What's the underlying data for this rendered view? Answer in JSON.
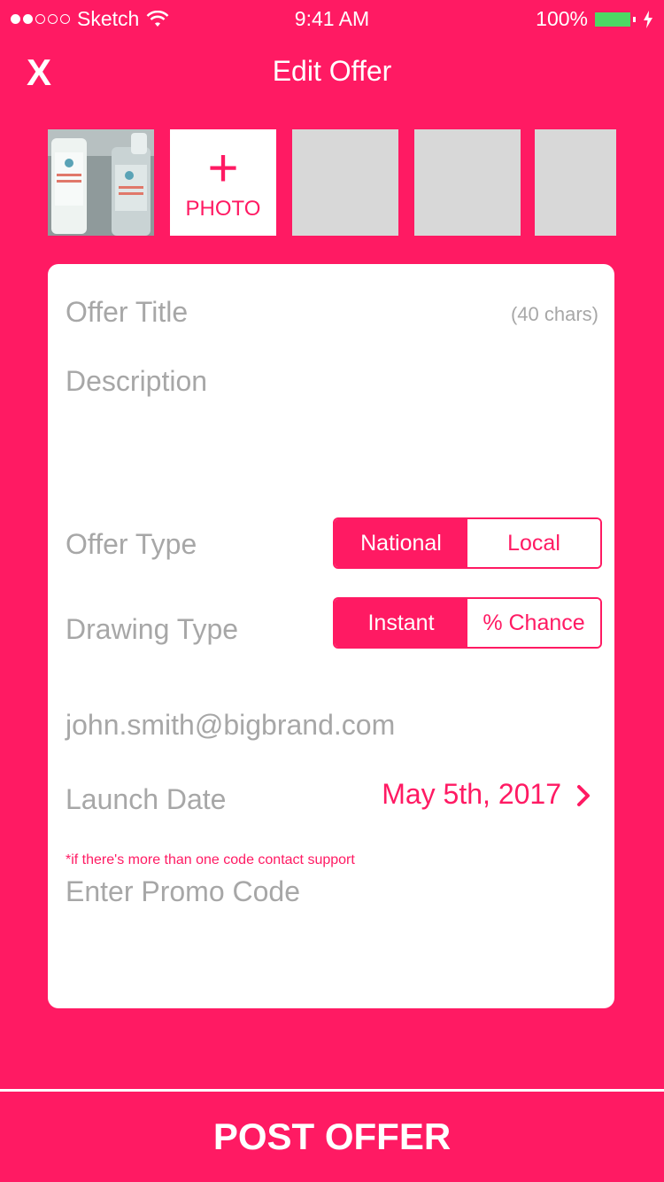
{
  "status_bar": {
    "carrier": "Sketch",
    "time": "9:41 AM",
    "battery": "100%",
    "battery_color": "#4CD964"
  },
  "nav": {
    "close_label": "X",
    "title": "Edit Offer"
  },
  "photos": {
    "add_label": "PHOTO",
    "add_icon": "plus-icon",
    "placeholder_color": "#D8D8D8"
  },
  "form": {
    "title_placeholder": "Offer Title",
    "title_limit": "(40 chars)",
    "description_placeholder": "Description",
    "offer_type_label": "Offer Type",
    "offer_type_options": [
      "National",
      "Local"
    ],
    "offer_type_selected": "National",
    "drawing_type_label": "Drawing Type",
    "drawing_type_options": [
      "Instant",
      "% Chance"
    ],
    "drawing_type_selected": "Instant",
    "email": "john.smith@bigbrand.com",
    "launch_label": "Launch Date",
    "launch_value": "May 5th, 2017",
    "promo_note": "*if there's more than one code contact support",
    "promo_placeholder": "Enter Promo Code"
  },
  "actions": {
    "post_label": "POST OFFER"
  },
  "colors": {
    "accent": "#FF1A63",
    "placeholder_text": "#A7A7A7",
    "card": "#FFFFFF"
  }
}
